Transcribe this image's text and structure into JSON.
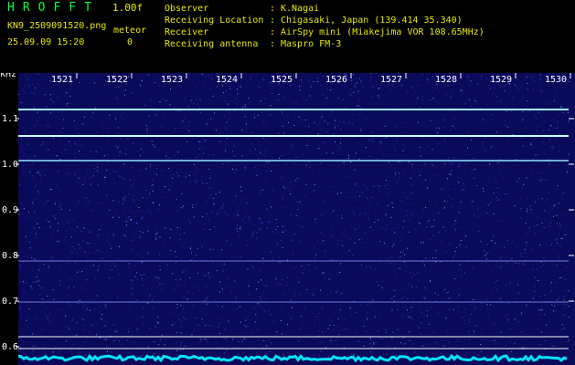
{
  "header": {
    "app_title": "HROFFT",
    "version": "1.00f",
    "filename": "KN9_2509091520.png",
    "meteor_label": "meteor",
    "timestamp": "25.09.09 15:20",
    "meteor_count": "0"
  },
  "info": [
    {
      "key": "Observer",
      "value": "K.Nagai"
    },
    {
      "key": "Receiving Location",
      "value": "Chigasaki, Japan (139.414 35.340)"
    },
    {
      "key": "Receiver",
      "value": "AirSpy mini (Miakejima VOR 108.65MHz)"
    },
    {
      "key": "Receiving antenna",
      "value": "Maspro FM-3"
    }
  ],
  "axes": {
    "y_unit": "kHz",
    "time_ticks": [
      "1521",
      "1522",
      "1523",
      "1524",
      "1525",
      "1526",
      "1527",
      "1528",
      "1529",
      "1530"
    ],
    "freq_ticks": [
      "1.1",
      "1.0",
      "0.9",
      "0.8",
      "0.7",
      "0.6"
    ]
  },
  "colors": {
    "background": "#000000",
    "spectrum_bg": "#0a0a5a",
    "text_yellow": "#e8e800",
    "title_green": "#00ff3c",
    "tick_white": "#ffffff",
    "signal_cyan": "#7fffff",
    "baseline_cyan": "#00e5ff"
  }
}
